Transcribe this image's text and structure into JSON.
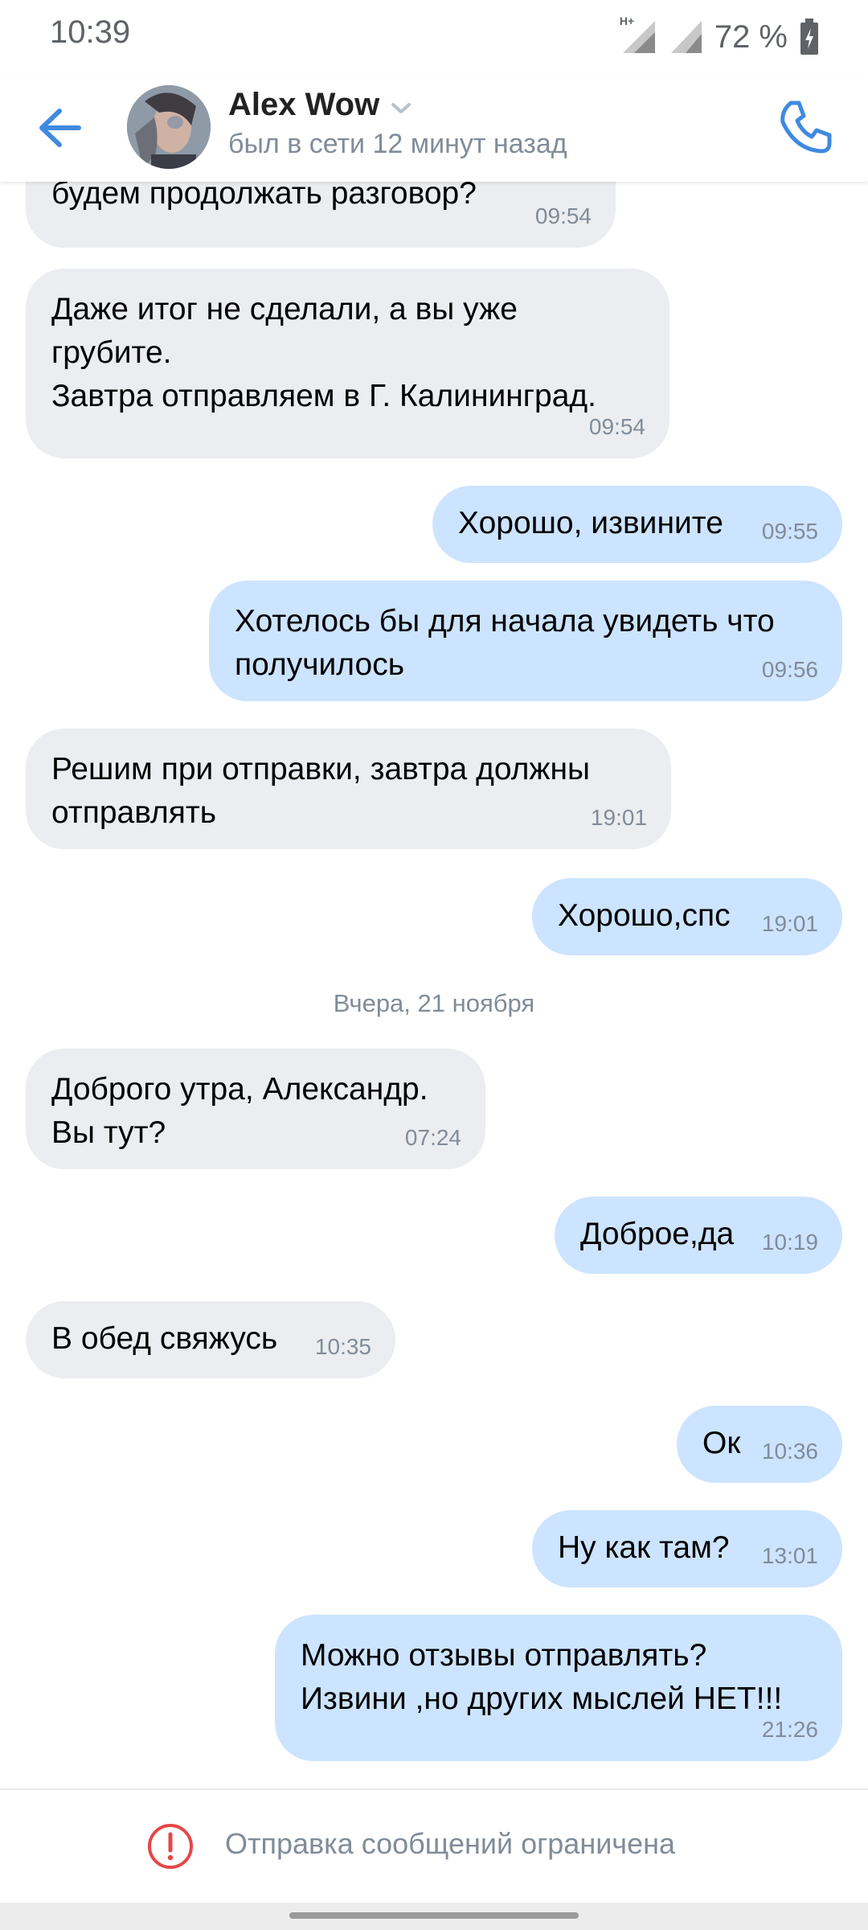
{
  "status_bar": {
    "time": "10:39",
    "network": "H+",
    "battery": "72 %"
  },
  "header": {
    "contact_name": "Alex Wow",
    "contact_status": "был в сети 12 минут назад"
  },
  "messages": [
    {
      "dir": "in",
      "text": "будем продолжать разговор?",
      "time": "09:54"
    },
    {
      "dir": "in",
      "text": "Даже итог не сделали, а вы уже\nгрубите.\nЗавтра отправляем в Г. Калининград.",
      "time": "09:54"
    },
    {
      "dir": "out",
      "text": "Хорошо, извините",
      "time": "09:55"
    },
    {
      "dir": "out",
      "text": "Хотелось бы для начала увидеть что\nполучилось",
      "time": "09:56"
    },
    {
      "dir": "in",
      "text": "Решим при отправки, завтра должны\nотправлять",
      "time": "19:01"
    },
    {
      "dir": "out",
      "text": "Хорошо,спс",
      "time": "19:01"
    },
    {
      "dir": "in",
      "text": "Доброго утра, Александр.\nВы тут?",
      "time": "07:24"
    },
    {
      "dir": "out",
      "text": "Доброе,да",
      "time": "10:19"
    },
    {
      "dir": "in",
      "text": "В обед свяжусь",
      "time": "10:35"
    },
    {
      "dir": "out",
      "text": "Ок",
      "time": "10:36"
    },
    {
      "dir": "out",
      "text": "Ну как там?",
      "time": "13:01"
    },
    {
      "dir": "out",
      "text": "Можно отзывы отправлять?\nИзвини ,но других мыслей НЕТ!!!",
      "time": "21:26"
    }
  ],
  "date_separator": "Вчера, 21 ноября",
  "bottom_bar": {
    "restriction_text": "Отправка сообщений ограничена"
  },
  "colors": {
    "accent": "#3f8ae0",
    "incoming_bubble": "#ebedf0",
    "outgoing_bubble": "#cce4ff",
    "secondary_text": "#818c99",
    "warning": "#e64646"
  }
}
